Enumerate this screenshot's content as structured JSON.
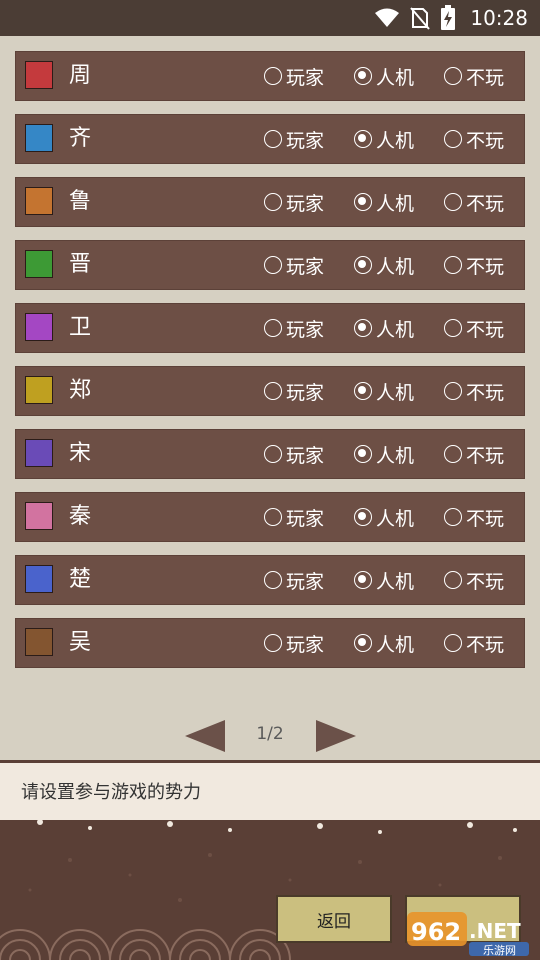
{
  "status_bar": {
    "time": "10:28",
    "icons": [
      "wifi-icon",
      "no-sim-icon",
      "battery-charging-icon"
    ]
  },
  "options": [
    "玩家",
    "人机",
    "不玩"
  ],
  "factions": [
    {
      "name": "周",
      "color": "#c43a3d",
      "selected": 1
    },
    {
      "name": "齐",
      "color": "#3587c6",
      "selected": 1
    },
    {
      "name": "鲁",
      "color": "#c47430",
      "selected": 1
    },
    {
      "name": "晋",
      "color": "#3d9a35",
      "selected": 1
    },
    {
      "name": "卫",
      "color": "#a447c3",
      "selected": 1
    },
    {
      "name": "郑",
      "color": "#bfa020",
      "selected": 1
    },
    {
      "name": "宋",
      "color": "#6a4bb7",
      "selected": 1
    },
    {
      "name": "秦",
      "color": "#d273a0",
      "selected": 1
    },
    {
      "name": "楚",
      "color": "#4a63cc",
      "selected": 1
    },
    {
      "name": "吴",
      "color": "#835530",
      "selected": 1
    }
  ],
  "pagination": {
    "label": "1/2",
    "prev_icon": "triangle-left-icon",
    "next_icon": "triangle-right-icon",
    "arrow_color": "#6b5149"
  },
  "hint": "请设置参与游戏的势力",
  "buttons": {
    "back": "返回"
  },
  "watermark": {
    "brand": "962.NET",
    "sub": "乐游网"
  }
}
